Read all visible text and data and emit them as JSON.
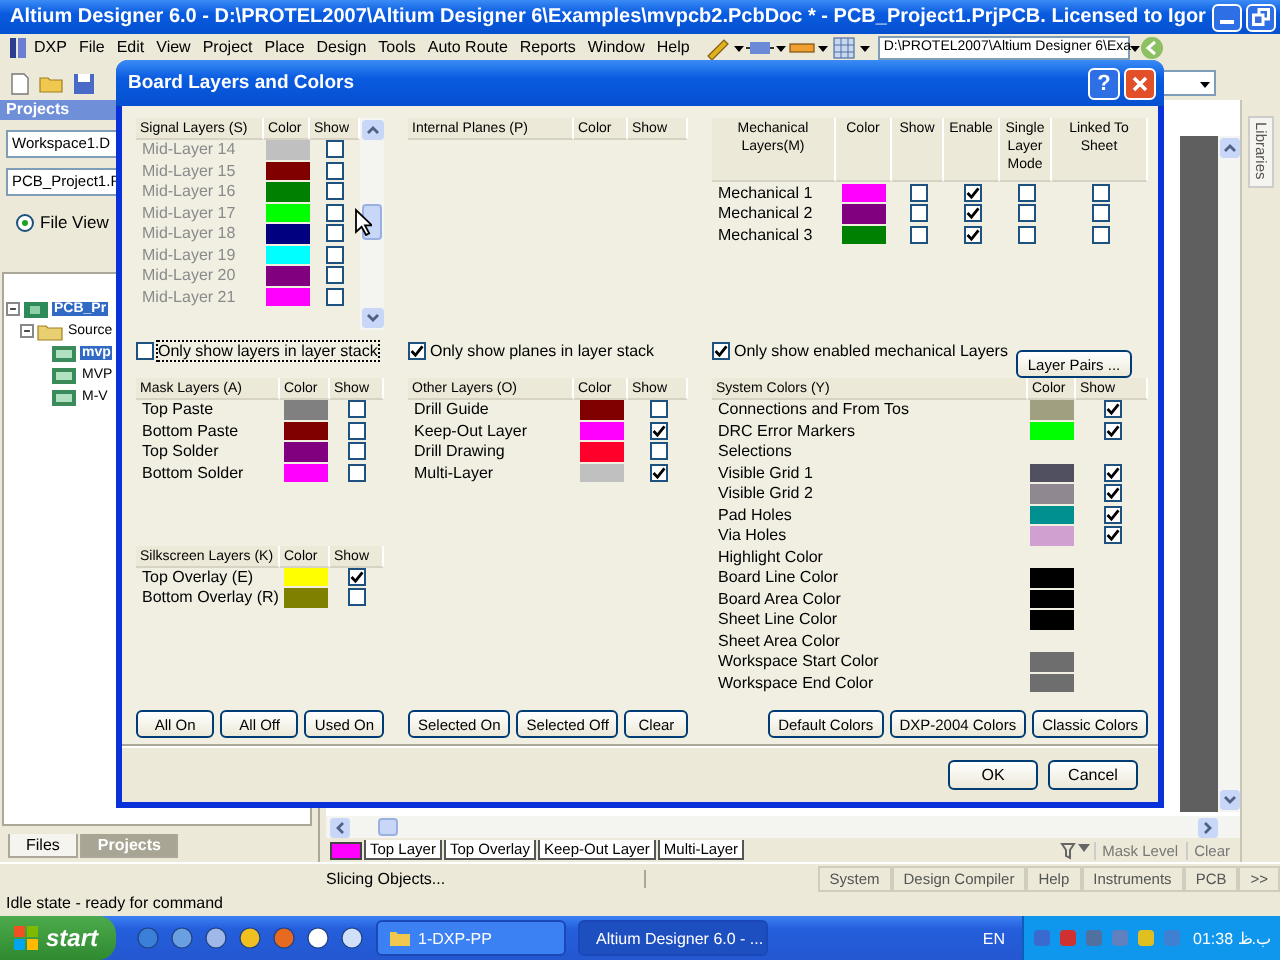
{
  "window": {
    "title": "Altium Designer 6.0 - D:\\PROTEL2007\\Altium Designer 6\\Examples\\mvpcb2.PcbDoc * - PCB_Project1.PrjPCB. Licensed to Igor"
  },
  "menu": [
    "DXP",
    "File",
    "Edit",
    "View",
    "Project",
    "Place",
    "Design",
    "Tools",
    "Auto Route",
    "Reports",
    "Window",
    "Help"
  ],
  "path_field": {
    "value": "D:\\PROTEL2007\\Altium Designer 6\\Exa"
  },
  "projects_panel": {
    "title": "Projects",
    "workspace": "Workspace1.D",
    "project": "PCB_Project1.F",
    "view_options": [
      {
        "label": "File View",
        "selected": true
      }
    ],
    "tree": [
      {
        "label": "PCB_Pr",
        "selected": true,
        "expanded": true,
        "children": [
          {
            "label": "Source",
            "selected": false,
            "expanded": true,
            "children": [
              {
                "label": "mvp",
                "selected": true
              },
              {
                "label": "MVP",
                "selected": false
              },
              {
                "label": "M-V",
                "selected": false
              }
            ]
          }
        ]
      }
    ],
    "tabs": [
      {
        "label": "Files",
        "selected": false
      },
      {
        "label": "Projects",
        "selected": true
      }
    ]
  },
  "side_tabs": [
    "Libraries"
  ],
  "dialog": {
    "title": "Board Layers and Colors",
    "help_button": "?",
    "signal_layers": {
      "columns": [
        "Signal Layers (S)",
        "Color",
        "Show"
      ],
      "rows": [
        {
          "name": "Mid-Layer 14",
          "color": "#c0c0c0",
          "show": false,
          "disabled": true
        },
        {
          "name": "Mid-Layer 15",
          "color": "#800000",
          "show": false,
          "disabled": true
        },
        {
          "name": "Mid-Layer 16",
          "color": "#008000",
          "show": false,
          "disabled": true
        },
        {
          "name": "Mid-Layer 17",
          "color": "#00ff00",
          "show": false,
          "disabled": true
        },
        {
          "name": "Mid-Layer 18",
          "color": "#000080",
          "show": false,
          "disabled": true
        },
        {
          "name": "Mid-Layer 19",
          "color": "#00ffff",
          "show": false,
          "disabled": true
        },
        {
          "name": "Mid-Layer 20",
          "color": "#800080",
          "show": false,
          "disabled": true
        },
        {
          "name": "Mid-Layer 21",
          "color": "#ff00ff",
          "show": false,
          "disabled": true
        }
      ]
    },
    "internal_planes": {
      "columns": [
        "Internal Planes (P)",
        "Color",
        "Show"
      ]
    },
    "mechanical_layers": {
      "columns": [
        "Mechanical Layers(M)",
        "Color",
        "Show",
        "Enable",
        "Single Layer Mode",
        "Linked To Sheet"
      ],
      "rows": [
        {
          "name": "Mechanical 1",
          "color": "#ff00ff",
          "show": false,
          "enable": true,
          "single_layer_mode": false,
          "linked_to_sheet": false
        },
        {
          "name": "Mechanical 2",
          "color": "#800080",
          "show": false,
          "enable": true,
          "single_layer_mode": false,
          "linked_to_sheet": false
        },
        {
          "name": "Mechanical 3",
          "color": "#008000",
          "show": false,
          "enable": true,
          "single_layer_mode": false,
          "linked_to_sheet": false
        }
      ]
    },
    "options": [
      {
        "label": "Only show layers in layer stack",
        "checked": false
      },
      {
        "label": "Only show planes in layer stack",
        "checked": true
      },
      {
        "label": "Only show enabled mechanical Layers",
        "checked": true
      }
    ],
    "layer_pairs_button": "Layer Pairs ...",
    "mask_layers": {
      "columns": [
        "Mask Layers (A)",
        "Color",
        "Show"
      ],
      "rows": [
        {
          "name": "Top Paste",
          "color": "#808080",
          "show": false
        },
        {
          "name": "Bottom Paste",
          "color": "#800000",
          "show": false
        },
        {
          "name": "Top Solder",
          "color": "#800080",
          "show": false
        },
        {
          "name": "Bottom Solder",
          "color": "#ff00ff",
          "show": false
        }
      ]
    },
    "silkscreen_layers": {
      "columns": [
        "Silkscreen Layers (K)",
        "Color",
        "Show"
      ],
      "rows": [
        {
          "name": "Top Overlay (E)",
          "color": "#ffff00",
          "show": true
        },
        {
          "name": "Bottom Overlay (R)",
          "color": "#808000",
          "show": false
        }
      ]
    },
    "other_layers": {
      "columns": [
        "Other Layers (O)",
        "Color",
        "Show"
      ],
      "rows": [
        {
          "name": "Drill Guide",
          "color": "#800000",
          "show": false
        },
        {
          "name": "Keep-Out Layer",
          "color": "#ff00ff",
          "show": true
        },
        {
          "name": "Drill Drawing",
          "color": "#ff002a",
          "show": false
        },
        {
          "name": "Multi-Layer",
          "color": "#c0c0c0",
          "show": true
        }
      ]
    },
    "system_colors": {
      "columns": [
        "System Colors (Y)",
        "Color",
        "Show"
      ],
      "rows": [
        {
          "name": "Connections and From Tos",
          "color": "#a0a080",
          "show": true
        },
        {
          "name": "DRC Error Markers",
          "color": "#00ff00",
          "show": true
        },
        {
          "name": "Selections"
        },
        {
          "name": "Visible Grid 1",
          "color": "#505060",
          "show": true
        },
        {
          "name": "Visible Grid 2",
          "color": "#908890",
          "show": true
        },
        {
          "name": "Pad Holes",
          "color": "#009090",
          "show": true
        },
        {
          "name": "Via Holes",
          "color": "#d0a0d0",
          "show": true
        },
        {
          "name": "Highlight Color"
        },
        {
          "name": "Board Line Color",
          "color": "#000000"
        },
        {
          "name": "Board Area Color",
          "color": "#000000"
        },
        {
          "name": "Sheet Line Color",
          "color": "#000000"
        },
        {
          "name": "Sheet Area Color"
        },
        {
          "name": "Workspace Start Color",
          "color": "#6e6e6e"
        },
        {
          "name": "Workspace End Color",
          "color": "#6e6e6e"
        }
      ]
    },
    "button_groups": [
      [
        "All On",
        "All Off",
        "Used On"
      ],
      [
        "Selected On",
        "Selected Off",
        "Clear"
      ],
      [
        "Default Colors",
        "DXP-2004 Colors",
        "Classic Colors"
      ]
    ],
    "footer_buttons": [
      "OK",
      "Cancel"
    ]
  },
  "layer_bar": {
    "color": "#ff00ff",
    "tabs": [
      "Top Layer",
      "Top Overlay",
      "Keep-Out Layer",
      "Multi-Layer"
    ],
    "controls": [
      "Mask Level",
      "Clear"
    ]
  },
  "status_bar": {
    "message": "Slicing Objects...",
    "panels": [
      "System",
      "Design Compiler",
      "Help",
      "Instruments",
      "PCB",
      ">>"
    ]
  },
  "status_line": "Idle state - ready for command",
  "taskbar": {
    "start": "start",
    "tasks": [
      {
        "label": "1-DXP-PP",
        "selected": false
      },
      {
        "label": "Altium Designer 6.0 - ...",
        "selected": true
      }
    ],
    "language": "EN",
    "time": "01:38 ب.ظ"
  }
}
